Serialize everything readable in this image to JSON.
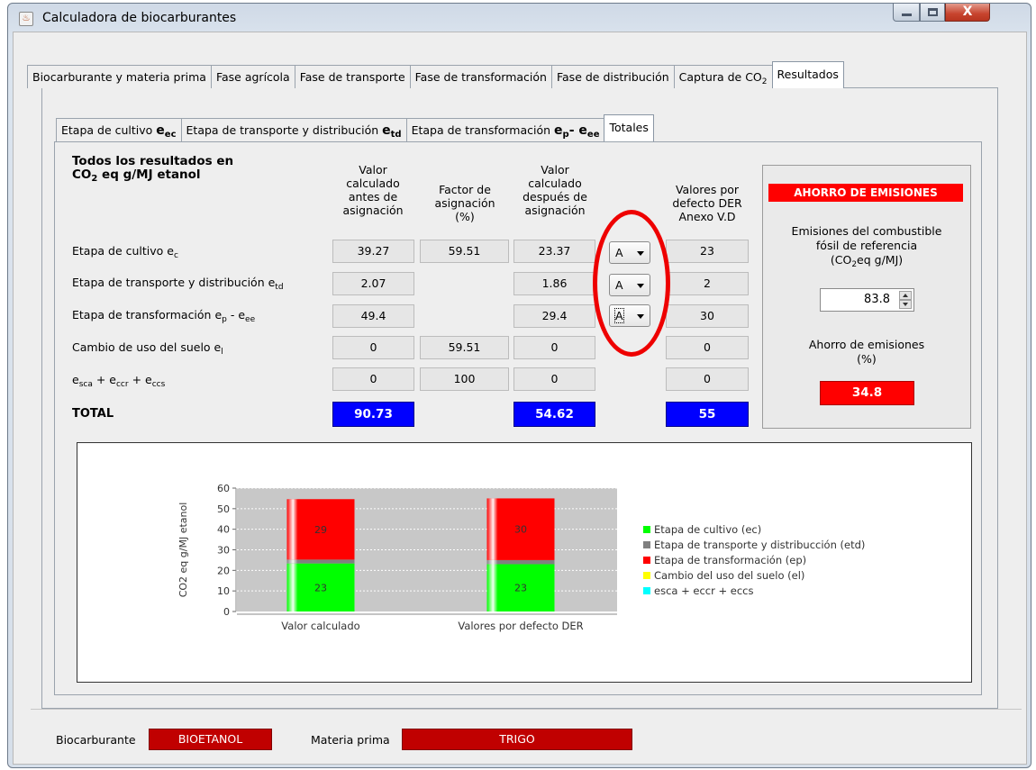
{
  "window": {
    "title": "Calculadora de biocarburantes",
    "close_label": "X"
  },
  "main_tabs": [
    {
      "label": "Biocarburante y materia prima"
    },
    {
      "label": "Fase agrícola"
    },
    {
      "label": "Fase de transporte"
    },
    {
      "label": "Fase de transformación"
    },
    {
      "label": "Fase de distribución"
    },
    {
      "label": "Captura de CO",
      "sub": "2"
    },
    {
      "label": "Resultados"
    }
  ],
  "inner_tabs": [
    {
      "label": "Etapa de cultivo ",
      "bold": "e",
      "sub": "ec"
    },
    {
      "label": "Etapa de transporte y distribución ",
      "bold": "e",
      "sub": "td"
    },
    {
      "label": "Etapa de transformación ",
      "bold": "e",
      "sub": "p",
      "bold2": "- e",
      "sub2": "ee"
    },
    {
      "label": "Totales"
    }
  ],
  "table": {
    "title_line1": "Todos los resultados en",
    "title_co": "CO",
    "title_sub": "2",
    "title_rest": " eq g/MJ etanol",
    "col_before": [
      "Valor",
      "calculado",
      "antes de",
      "asignación"
    ],
    "col_factor": [
      "Factor de",
      "asignación",
      "(%)"
    ],
    "col_after": [
      "Valor",
      "calculado",
      "después de",
      "asignación"
    ],
    "col_default": [
      "Valores por",
      "defecto DER",
      "Anexo V.D"
    ],
    "rows": [
      {
        "label": "Etapa de cultivo e",
        "sub": "c",
        "suffix": "",
        "sub2": "",
        "before": "39.27",
        "factor": "59.51",
        "after": "23.37",
        "combo": "A",
        "default": "23"
      },
      {
        "label": "Etapa de transporte y distribución e",
        "sub": "td",
        "suffix": "",
        "sub2": "",
        "before": "2.07",
        "factor": "",
        "after": "1.86",
        "combo": "A",
        "default": "2"
      },
      {
        "label": "Etapa de transformación e",
        "sub": "p",
        "suffix": " - e",
        "sub2": "ee",
        "before": "49.4",
        "factor": "",
        "after": "29.4",
        "combo": "A",
        "default": "30"
      },
      {
        "label": "Cambio de uso del suelo e",
        "sub": "l",
        "suffix": "",
        "sub2": "",
        "before": "0",
        "factor": "59.51",
        "after": "0",
        "combo": "",
        "default": "0"
      },
      {
        "label": "e",
        "sub": "sca",
        "suffix": " + e",
        "sub2": "ccr",
        "suffix2": " + e",
        "sub3": "ccs",
        "before": "0",
        "factor": "100",
        "after": "0",
        "combo": "",
        "default": "0"
      }
    ],
    "total_label": "TOTAL",
    "total_before": "90.73",
    "total_after": "54.62",
    "total_default": "55"
  },
  "ahorro": {
    "title": "AHORRO DE EMISIONES",
    "ref_line1": "Emisiones del combustible",
    "ref_line2": "fósil de referencia",
    "ref_co": "(CO",
    "ref_sub": "2",
    "ref_rest": "eq g/MJ)",
    "ref_value": "83.8",
    "savings_line1": "Ahorro de emisiones",
    "savings_line2": "(%)",
    "savings_value": "34.8"
  },
  "chart_data": {
    "type": "bar",
    "stacked": true,
    "categories": [
      "Valor calculado",
      "Valores por defecto DER"
    ],
    "ylabel": "CO2 eq g/MJ etanol",
    "ylim": [
      0,
      60
    ],
    "yticks": [
      0,
      10,
      20,
      30,
      40,
      50,
      60
    ],
    "series": [
      {
        "name": "Etapa de cultivo (ec)",
        "color": "#00ff00",
        "values": [
          23.37,
          23
        ],
        "labels": [
          "23",
          "23"
        ]
      },
      {
        "name": "Etapa de transporte y distribucción (etd)",
        "color": "#808080",
        "values": [
          1.86,
          2
        ],
        "labels": [
          "",
          ""
        ]
      },
      {
        "name": "Etapa de transformación (ep)",
        "color": "#ff0000",
        "values": [
          29.4,
          30
        ],
        "labels": [
          "29",
          "30"
        ]
      },
      {
        "name": "Cambio del uso del suelo (el)",
        "color": "#ffff00",
        "values": [
          0,
          0
        ],
        "labels": [
          "",
          ""
        ]
      },
      {
        "name": "esca + eccr + eccs",
        "color": "#00ffff",
        "values": [
          0,
          0
        ],
        "labels": [
          "",
          ""
        ]
      }
    ]
  },
  "bottom": {
    "biocarburante_label": "Biocarburante",
    "biocarburante_value": "BIOETANOL",
    "materia_label": "Materia prima",
    "materia_value": "TRIGO"
  }
}
